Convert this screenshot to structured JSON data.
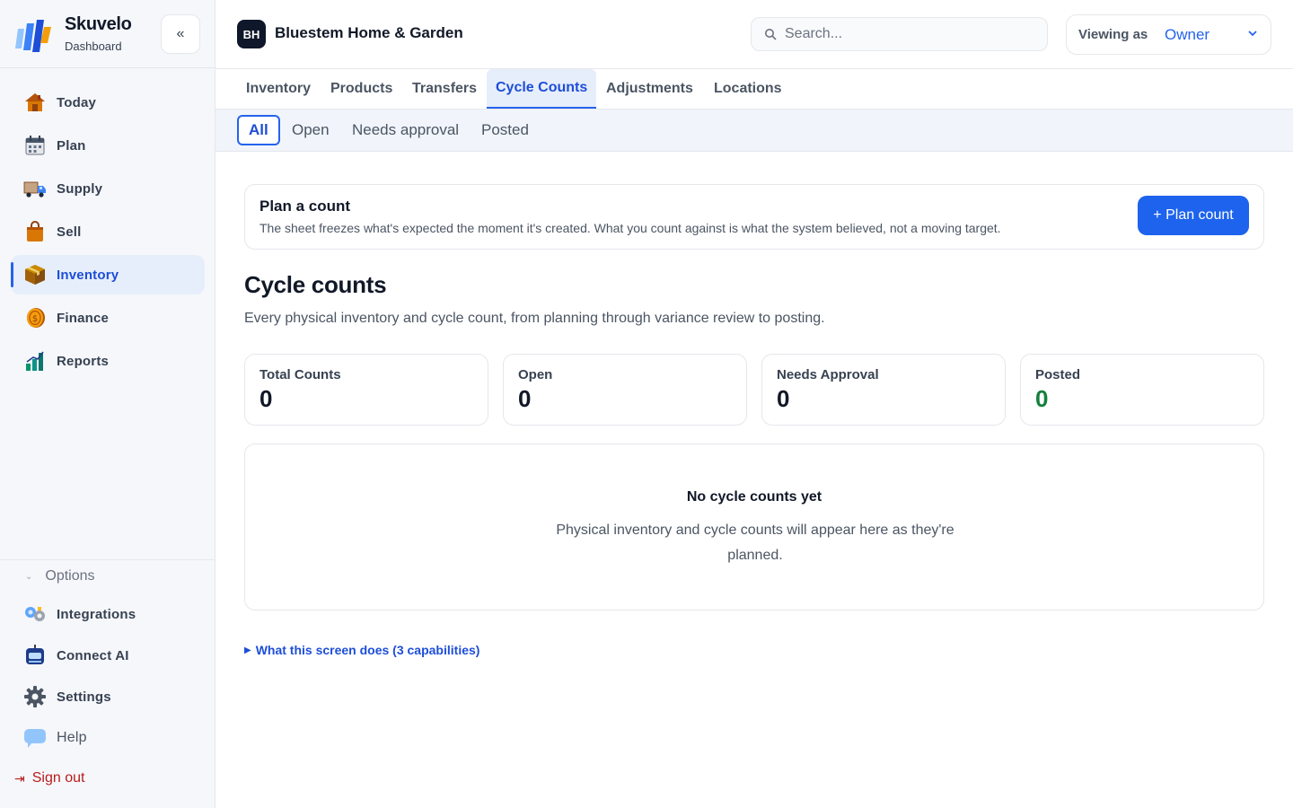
{
  "brand": {
    "name": "Skuvelo",
    "subtitle": "Dashboard",
    "collapse_icon": "«"
  },
  "sidebar": {
    "items": [
      {
        "label": "Today",
        "icon": "house-icon"
      },
      {
        "label": "Plan",
        "icon": "calendar-icon"
      },
      {
        "label": "Supply",
        "icon": "truck-icon"
      },
      {
        "label": "Sell",
        "icon": "shopping-bag-icon"
      },
      {
        "label": "Inventory",
        "icon": "box-icon",
        "active": true
      },
      {
        "label": "Finance",
        "icon": "coin-icon"
      },
      {
        "label": "Reports",
        "icon": "bar-chart-icon"
      }
    ],
    "options_label": "Options",
    "options_chevron": "⌄",
    "options_items": [
      {
        "label": "Integrations",
        "icon": "puzzle-icon"
      },
      {
        "label": "Connect AI",
        "icon": "robot-icon"
      },
      {
        "label": "Settings",
        "icon": "gear-icon"
      },
      {
        "label": "Help",
        "icon": "speech-bubble-icon"
      }
    ],
    "signout_label": "Sign out",
    "signout_icon": "⇥"
  },
  "header": {
    "org_initials": "BH",
    "org_name": "Bluestem Home & Garden",
    "search_placeholder": "Search...",
    "viewing_as_label": "Viewing as",
    "viewing_as_value": "Owner"
  },
  "tabs": [
    {
      "label": "Inventory"
    },
    {
      "label": "Products"
    },
    {
      "label": "Transfers"
    },
    {
      "label": "Cycle Counts",
      "active": true
    },
    {
      "label": "Adjustments"
    },
    {
      "label": "Locations"
    }
  ],
  "subtabs": [
    {
      "label": "All",
      "active": true
    },
    {
      "label": "Open"
    },
    {
      "label": "Needs approval"
    },
    {
      "label": "Posted"
    }
  ],
  "plan_card": {
    "title": "Plan a count",
    "description": "The sheet freezes what's expected the moment it's created. What you count against is what the system believed, not a moving target.",
    "button": "+ Plan count"
  },
  "page": {
    "title": "Cycle counts",
    "description": "Every physical inventory and cycle count, from planning through variance review to posting."
  },
  "stats": [
    {
      "label": "Total Counts",
      "value": "0"
    },
    {
      "label": "Open",
      "value": "0"
    },
    {
      "label": "Needs Approval",
      "value": "0"
    },
    {
      "label": "Posted",
      "value": "0",
      "color": "#15803d"
    }
  ],
  "empty_state": {
    "title": "No cycle counts yet",
    "description": "Physical inventory and cycle counts will appear here as they're planned."
  },
  "capabilities": {
    "toggle_icon": "▶",
    "label": "What this screen does (3 capabilities)"
  },
  "colors": {
    "accent": "#2563eb",
    "button": "#1d63ed",
    "danger": "#b91c1c",
    "success": "#15803d"
  }
}
